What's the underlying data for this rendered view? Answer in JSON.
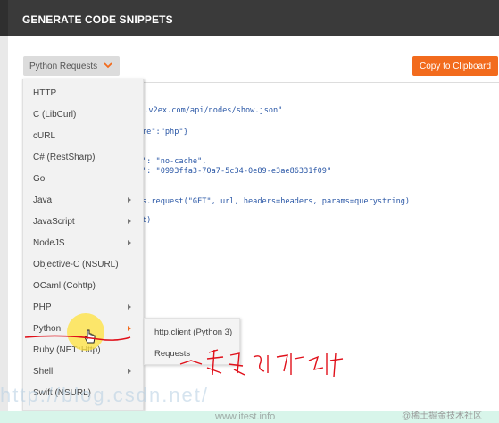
{
  "modal": {
    "title": "GENERATE CODE SNIPPETS"
  },
  "language_select": {
    "selected": "Python Requests",
    "icon": "chevron-down-icon",
    "accent": "#f26b1d"
  },
  "copy_button": {
    "label": "Copy to Clipboard",
    "color": "#f26b1d"
  },
  "code_lines": [
    "s.v2ex.com/api/nodes/show.json\"",
    "me\":\"php\"}",
    "': \"no-cache\",",
    "': \"0993ffa3-70a7-5c34-0e89-e3ae86331f09\"",
    "s.request(\"GET\", url, headers=headers, params=querystring)",
    "t)"
  ],
  "languages": [
    {
      "label": "HTTP",
      "has_submenu": false
    },
    {
      "label": "C (LibCurl)",
      "has_submenu": false
    },
    {
      "label": "cURL",
      "has_submenu": false
    },
    {
      "label": "C# (RestSharp)",
      "has_submenu": false
    },
    {
      "label": "Go",
      "has_submenu": false
    },
    {
      "label": "Java",
      "has_submenu": true
    },
    {
      "label": "JavaScript",
      "has_submenu": true
    },
    {
      "label": "NodeJS",
      "has_submenu": true
    },
    {
      "label": "Objective-C (NSURL)",
      "has_submenu": false
    },
    {
      "label": "OCaml (Cohttp)",
      "has_submenu": false
    },
    {
      "label": "PHP",
      "has_submenu": true
    },
    {
      "label": "Python",
      "has_submenu": true,
      "active": true
    },
    {
      "label": "Ruby (NET::Http)",
      "has_submenu": false
    },
    {
      "label": "Shell",
      "has_submenu": true
    },
    {
      "label": "Swift (NSURL)",
      "has_submenu": false
    }
  ],
  "python_submenu": [
    {
      "label": "http.client (Python 3)"
    },
    {
      "label": "Requests"
    }
  ],
  "annotation": {
    "text": "采用了哪几种方法",
    "color": "#e0101a"
  },
  "watermark": {
    "text": "http://blog.csdn.net/",
    "site": "www.itest.info",
    "corner": "@稀土掘金技术社区"
  }
}
